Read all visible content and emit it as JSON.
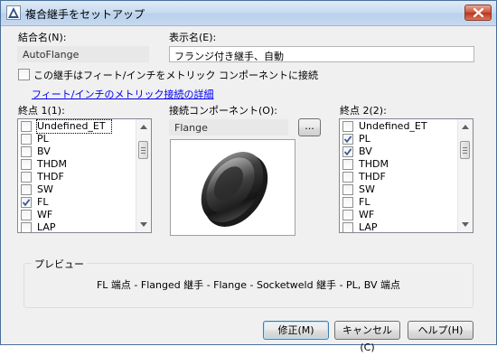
{
  "window": {
    "title": "複合継手をセットアップ",
    "close_label": "×"
  },
  "fields": {
    "joint_name_label": "結合名(N):",
    "joint_name_value": "AutoFlange",
    "display_name_label": "表示名(E):",
    "display_name_value": "フランジ付き継手、自動"
  },
  "metric_checkbox": {
    "label": "この継手はフィート/インチをメトリック コンポーネントに接続",
    "checked": false
  },
  "metric_link": "フィート/インチのメトリック接続の詳細",
  "endpoint1": {
    "label": "終点 1(1):",
    "items": [
      {
        "label": "Undefined_ET",
        "checked": false
      },
      {
        "label": "PL",
        "checked": false
      },
      {
        "label": "BV",
        "checked": false
      },
      {
        "label": "THDM",
        "checked": false
      },
      {
        "label": "THDF",
        "checked": false
      },
      {
        "label": "SW",
        "checked": false
      },
      {
        "label": "FL",
        "checked": true
      },
      {
        "label": "WF",
        "checked": false
      },
      {
        "label": "LAP",
        "checked": false
      }
    ]
  },
  "connection": {
    "label": "接続コンポーネント(O):",
    "value": "Flange",
    "browse_label": "..."
  },
  "endpoint2": {
    "label": "終点 2(2):",
    "items": [
      {
        "label": "Undefined_ET",
        "checked": false
      },
      {
        "label": "PL",
        "checked": true
      },
      {
        "label": "BV",
        "checked": true
      },
      {
        "label": "THDM",
        "checked": false
      },
      {
        "label": "THDF",
        "checked": false
      },
      {
        "label": "SW",
        "checked": false
      },
      {
        "label": "FL",
        "checked": false
      },
      {
        "label": "WF",
        "checked": false
      },
      {
        "label": "LAP",
        "checked": false
      }
    ]
  },
  "preview": {
    "label": "プレビュー",
    "text": "FL 端点 - Flanged 継手 - Flange - Socketweld 継手 - PL, BV 端点"
  },
  "buttons": {
    "modify": "修正(M)",
    "cancel": "キャンセル(C)",
    "help": "ヘルプ(H)"
  },
  "colors": {
    "title_gradient": "#c9dcf0",
    "link": "#0000ee",
    "check": "#3c5a9a"
  }
}
